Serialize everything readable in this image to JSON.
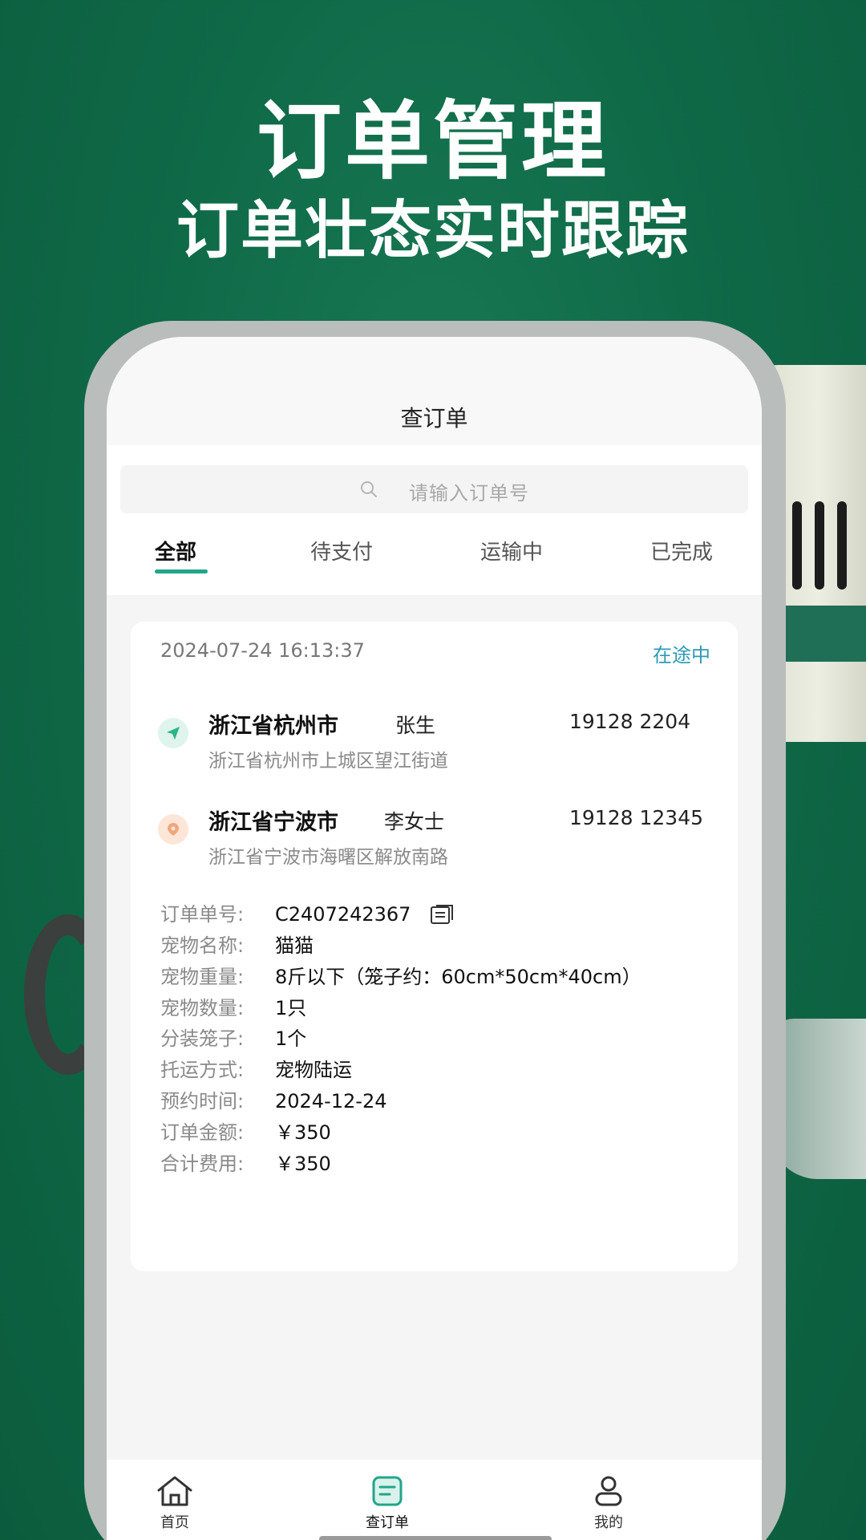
{
  "promo": {
    "title": "订单管理",
    "subtitle": "订单壮态实时跟踪"
  },
  "nav": {
    "title": "查订单"
  },
  "search": {
    "placeholder": "请输入订单号"
  },
  "tabs": [
    {
      "label": "全部",
      "active": true
    },
    {
      "label": "待支付",
      "active": false
    },
    {
      "label": "运输中",
      "active": false
    },
    {
      "label": "已完成",
      "active": false
    }
  ],
  "order": {
    "datetime": "2024-07-24 16:13:37",
    "status": "在途中",
    "from": {
      "city": "浙江省杭州市",
      "name": "张生",
      "phone": "19128  2204",
      "address": "浙江省杭州市上城区望江街道"
    },
    "to": {
      "city": "浙江省宁波市",
      "name": "李女士",
      "phone": "19128   12345",
      "address": "浙江省宁波市海曙区解放南路"
    },
    "details": [
      {
        "label": "订单单号:",
        "value": "C2407242367"
      },
      {
        "label": "宠物名称:",
        "value": "猫猫"
      },
      {
        "label": "宠物重量:",
        "value": "8斤以下（笼子约：60cm*50cm*40cm）"
      },
      {
        "label": "宠物数量:",
        "value": "1只"
      },
      {
        "label": "分装笼子:",
        "value": "1个"
      },
      {
        "label": "托运方式:",
        "value": "宠物陆运"
      },
      {
        "label": "预约时间:",
        "value": "2024-12-24"
      },
      {
        "label": "订单金额:",
        "value": "￥350"
      },
      {
        "label": "合计费用:",
        "value": "￥350"
      }
    ]
  },
  "tabbar": [
    {
      "label": "首页",
      "icon": "home-icon"
    },
    {
      "label": "查订单",
      "icon": "order-icon",
      "active": true
    },
    {
      "label": "我的",
      "icon": "user-icon"
    }
  ],
  "colors": {
    "accent": "#22a58a",
    "status": "#2e9ab5",
    "background": "#0f6a48"
  }
}
